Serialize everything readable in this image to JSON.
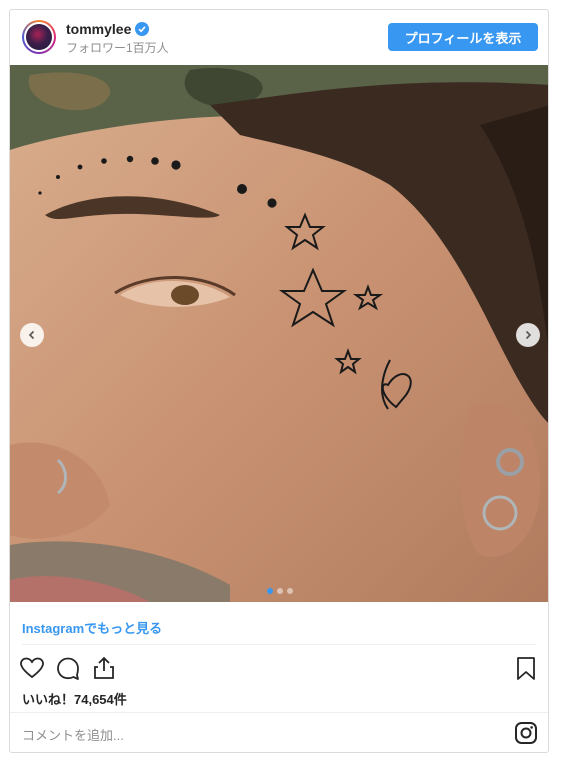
{
  "header": {
    "username": "tommylee",
    "followers": "フォロワー1百万人",
    "profile_button": "プロフィールを表示"
  },
  "post": {
    "more_link": "Instagramでもっと見る",
    "likes": "いいね！74,654件",
    "comment_placeholder": "コメントを追加...",
    "carousel_pages": 3,
    "carousel_current": 1
  },
  "colors": {
    "accent": "#3897f0",
    "border": "#dbdbdb",
    "muted_text": "#8e8e8e"
  },
  "icons": [
    "verified-badge-icon",
    "chevron-left-icon",
    "chevron-right-icon",
    "heart-icon",
    "comment-icon",
    "share-icon",
    "bookmark-icon",
    "instagram-icon"
  ]
}
